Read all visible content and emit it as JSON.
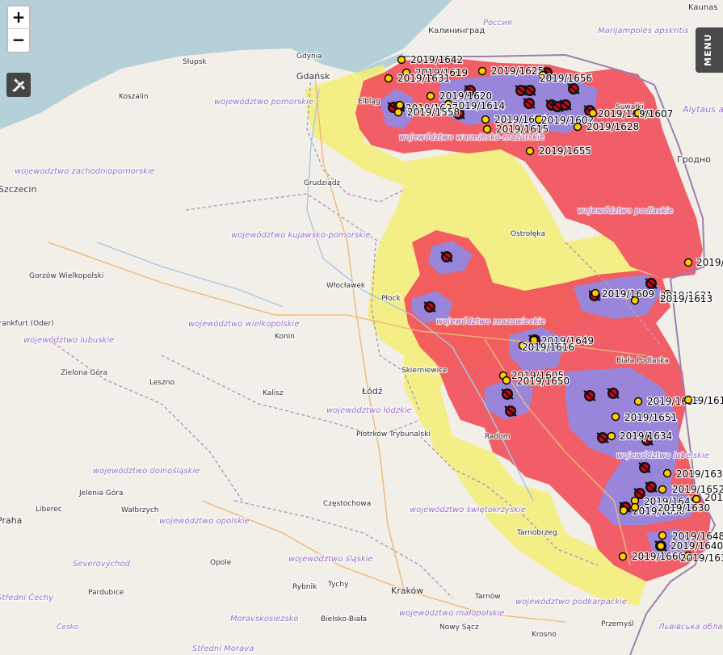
{
  "controls": {
    "zoom_in": "+",
    "zoom_out": "−",
    "menu": "MENU",
    "draw_icon": "pencil-ruler-icon"
  },
  "colors": {
    "sea": "#b6d0d9",
    "land": "#f2efe9",
    "red_zone": "#f14e59",
    "yellow_zone": "#f4ed74",
    "blue_zone": "#8f8be8",
    "border": "#b49fbd",
    "outbreak": "#e2001a",
    "marker": "#ffcc00"
  },
  "places": [
    {
      "t": "Kaunas"
    },
    {
      "t": "Калининград"
    },
    {
      "t": "Россия"
    },
    {
      "t": "Marijampolės apskritis"
    },
    {
      "t": "Alytaus a"
    },
    {
      "t": "Gdynia"
    },
    {
      "t": "Słupsk"
    },
    {
      "t": "Gdańsk"
    },
    {
      "t": "Elbląg"
    },
    {
      "t": "Koszalin"
    },
    {
      "t": "województwo pomorskie"
    },
    {
      "t": "Suwałki"
    },
    {
      "t": "województwo warmińsko-mazurskie"
    },
    {
      "t": "Гродно"
    },
    {
      "t": "województwo zachodniopomorskie"
    },
    {
      "t": "Szczecin"
    },
    {
      "t": "Grudziądz"
    },
    {
      "t": "województwo podlaskie"
    },
    {
      "t": "Ostrołęka"
    },
    {
      "t": "województwo kujawsko-pomorskie"
    },
    {
      "t": "Gorzów Wielkopolski"
    },
    {
      "t": "Włocławek"
    },
    {
      "t": "Płock"
    },
    {
      "t": "Frankfurt (Oder)"
    },
    {
      "t": "województwo wielkopolskie"
    },
    {
      "t": "województwo mazowieckie"
    },
    {
      "t": "województwo lubuskie"
    },
    {
      "t": "Konin"
    },
    {
      "t": "Biała Podlaska"
    },
    {
      "t": "Zielona Góra"
    },
    {
      "t": "Leszno"
    },
    {
      "t": "Kalisz"
    },
    {
      "t": "Łódź"
    },
    {
      "t": "Skierniewice"
    },
    {
      "t": "województwo łódzkie"
    },
    {
      "t": "Piotrków Trybunalski"
    },
    {
      "t": "Radom"
    },
    {
      "t": "województwo lubelskie"
    },
    {
      "t": "województwo dolnośląskie"
    },
    {
      "t": "Jelenia Góra"
    },
    {
      "t": "Wałbrzych"
    },
    {
      "t": "Liberec"
    },
    {
      "t": "Częstochowa"
    },
    {
      "t": "województwo opolskie"
    },
    {
      "t": "województwo świętokrzyskie"
    },
    {
      "t": "Tarnobrzeg"
    },
    {
      "t": "Severovýchod"
    },
    {
      "t": "Praha"
    },
    {
      "t": "województwo śląskie"
    },
    {
      "t": "Opole"
    },
    {
      "t": "Pardubice"
    },
    {
      "t": "Rybnik"
    },
    {
      "t": "Tychy"
    },
    {
      "t": "Kraków"
    },
    {
      "t": "Tarnów"
    },
    {
      "t": "województwo podkarpackie"
    },
    {
      "t": "Střední Čechy"
    },
    {
      "t": "Moravskoslezsko"
    },
    {
      "t": "Bielsko-Biała"
    },
    {
      "t": "województwo małopolskie"
    },
    {
      "t": "Česko"
    },
    {
      "t": "Nowy Sącz"
    },
    {
      "t": "Krosno"
    },
    {
      "t": "Przemyśl"
    },
    {
      "t": "Львівська обла"
    },
    {
      "t": "Střední Morava"
    }
  ],
  "markers": [
    {
      "label": "2019/1642"
    },
    {
      "label": "2019/1625"
    },
    {
      "label": "2019/1619"
    },
    {
      "label": "2019/1631"
    },
    {
      "label": "2019/1656"
    },
    {
      "label": "2019/1620"
    },
    {
      "label": "2019/1614"
    },
    {
      "label": "2019/1637"
    },
    {
      "label": "2019/1558"
    },
    {
      "label": "2019/1654"
    },
    {
      "label": "2019/1615"
    },
    {
      "label": "2019/1602"
    },
    {
      "label": "2019/1608"
    },
    {
      "label": "9/1607"
    },
    {
      "label": "2019/1628"
    },
    {
      "label": "2019/1655"
    },
    {
      "label": "2019/1"
    },
    {
      "label": "2019/1609"
    },
    {
      "label": "2019/1621"
    },
    {
      "label": "2019/1613"
    },
    {
      "label": "2019/1649"
    },
    {
      "label": "2019/1616"
    },
    {
      "label": "2019/1605"
    },
    {
      "label": "2019/1650"
    },
    {
      "label": "2019/1635"
    },
    {
      "label": "19/161"
    },
    {
      "label": "2019/1651"
    },
    {
      "label": "2019/1634"
    },
    {
      "label": "2019/1633"
    },
    {
      "label": "2019/1652"
    },
    {
      "label": "2019/1645"
    },
    {
      "label": "2019/1636"
    },
    {
      "label": "2019/1630"
    },
    {
      "label": "2019/1648"
    },
    {
      "label": "2019/1640"
    },
    {
      "label": "2019/1660"
    },
    {
      "label": "2019/163"
    },
    {
      "label": "2019/164"
    }
  ]
}
